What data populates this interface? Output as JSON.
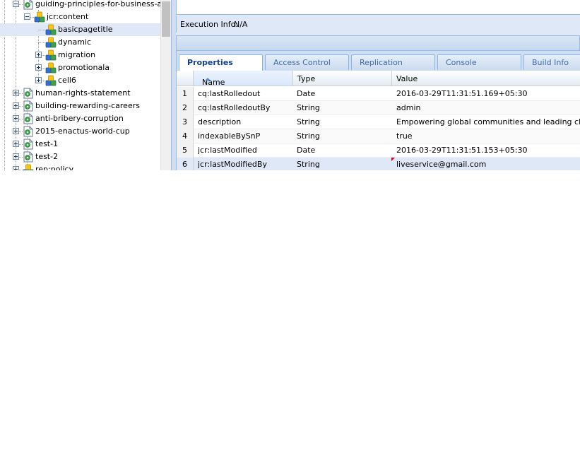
{
  "tree": {
    "nodes": [
      {
        "label": "guiding-principles-for-business-ar",
        "state": "expanded",
        "icon": "page-node-icon"
      },
      {
        "label": "jcr:content",
        "state": "expanded",
        "icon": "content-node-icon"
      },
      {
        "label": "basicpagetitle",
        "state": "leaf",
        "icon": "component-node-icon",
        "selected": true
      },
      {
        "label": "dynamic",
        "state": "leaf",
        "icon": "component-node-icon"
      },
      {
        "label": "migration",
        "state": "collapsed",
        "icon": "component-node-icon"
      },
      {
        "label": "promotionala",
        "state": "collapsed",
        "icon": "component-node-icon"
      },
      {
        "label": "cell6",
        "state": "collapsed",
        "icon": "component-node-icon"
      },
      {
        "label": "human-rights-statement",
        "state": "collapsed",
        "icon": "page-node-icon"
      },
      {
        "label": "building-rewarding-careers",
        "state": "collapsed",
        "icon": "page-node-icon"
      },
      {
        "label": "anti-bribery-corruption",
        "state": "collapsed",
        "icon": "page-node-icon"
      },
      {
        "label": "2015-enactus-world-cup",
        "state": "collapsed",
        "icon": "page-node-icon"
      },
      {
        "label": "test-1",
        "state": "collapsed",
        "icon": "page-node-icon"
      },
      {
        "label": "test-2",
        "state": "collapsed",
        "icon": "page-node-icon"
      },
      {
        "label": "rep:policy",
        "state": "collapsed",
        "icon": "policy-node-icon"
      }
    ]
  },
  "exec": {
    "label": "Execution Info:",
    "value": "N/A"
  },
  "tabs": [
    {
      "label": "Properties",
      "active": true
    },
    {
      "label": "Access Control"
    },
    {
      "label": "Replication"
    },
    {
      "label": "Console"
    },
    {
      "label": "Build Info"
    }
  ],
  "grid": {
    "columns": [
      {
        "label": "Name",
        "sorted": "asc"
      },
      {
        "label": "Type"
      },
      {
        "label": "Value"
      }
    ],
    "rows": [
      {
        "num": "1",
        "name": "cq:lastRolledout",
        "type": "Date",
        "value": "2016-03-29T11:31:51.169+05:30"
      },
      {
        "num": "2",
        "name": "cq:lastRolledoutBy",
        "type": "String",
        "value": "admin"
      },
      {
        "num": "3",
        "name": "description",
        "type": "String",
        "value": "Empowering global communities and leading change in"
      },
      {
        "num": "4",
        "name": "indexableBySnP",
        "type": "String",
        "value": "true"
      },
      {
        "num": "5",
        "name": "jcr:lastModified",
        "type": "Date",
        "value": "2016-03-29T11:31:51.153+05:30"
      },
      {
        "num": "6",
        "name": "jcr:lastModifiedBy",
        "type": "String",
        "value": "liveservice@gmail.com",
        "selected": true,
        "dirty": true
      }
    ]
  },
  "colors": {
    "selection": "#dfe8f6",
    "tab_text": "#15428b",
    "panel_border": "#99bbe8",
    "dirty_marker": "#d8002b"
  }
}
